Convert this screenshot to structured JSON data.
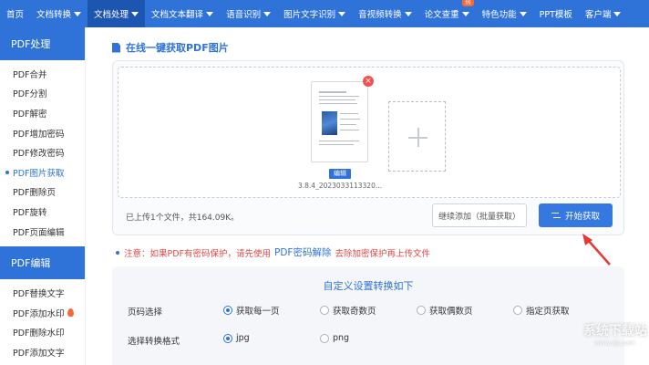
{
  "nav": {
    "items": [
      {
        "label": "首页",
        "dropdown": false
      },
      {
        "label": "文档转换",
        "dropdown": true
      },
      {
        "label": "文档处理",
        "dropdown": true
      },
      {
        "label": "文档文本翻译",
        "dropdown": true
      },
      {
        "label": "语音识别",
        "dropdown": true
      },
      {
        "label": "图片文字识别",
        "dropdown": true
      },
      {
        "label": "音视频转换",
        "dropdown": true
      },
      {
        "label": "论文查重",
        "dropdown": true
      },
      {
        "label": "特色功能",
        "dropdown": true
      },
      {
        "label": "PPT模板",
        "dropdown": false
      },
      {
        "label": "客户端",
        "dropdown": true
      }
    ],
    "active_index": 2,
    "badge_label": "热",
    "accent_color": "#2f73d9"
  },
  "sidebar": {
    "section1_title": "PDF处理",
    "section1_items": [
      "PDF合并",
      "PDF分割",
      "PDF解密",
      "PDF增加密码",
      "PDF修改密码",
      "PDF图片获取",
      "PDF删除页",
      "PDF旋转",
      "PDF页面编辑"
    ],
    "active_item": "PDF图片获取",
    "section2_title": "PDF编辑",
    "section2_items": [
      "PDF替换文字",
      "PDF添加水印",
      "PDF删除水印",
      "PDF添加文字"
    ]
  },
  "main": {
    "title": "在线一键获取PDF图片",
    "file": {
      "name": "3.8.4_2023033113320...",
      "edit_label": "编辑",
      "delete_icon": "close-icon"
    },
    "upload_status": "已上传1个文件，共164.09K。",
    "continue_button": "继续添加（批量获取）",
    "start_button": "开始获取",
    "note_prefix": "注意：如果PDF有密码保护，请先使用",
    "note_link": "PDF密码解除",
    "note_suffix": "去除加密保护再上传文件"
  },
  "settings": {
    "title": "自定义设置转换如下",
    "page_label": "页码选择",
    "page_options": [
      "获取每一页",
      "获取奇数页",
      "获取偶数页",
      "指定页获取"
    ],
    "page_selected": 0,
    "format_label": "选择转换格式",
    "format_options": [
      "jpg",
      "png"
    ],
    "format_selected": 0
  },
  "watermark": {
    "text": "系统下载站",
    "sub": "www.xp.com"
  }
}
